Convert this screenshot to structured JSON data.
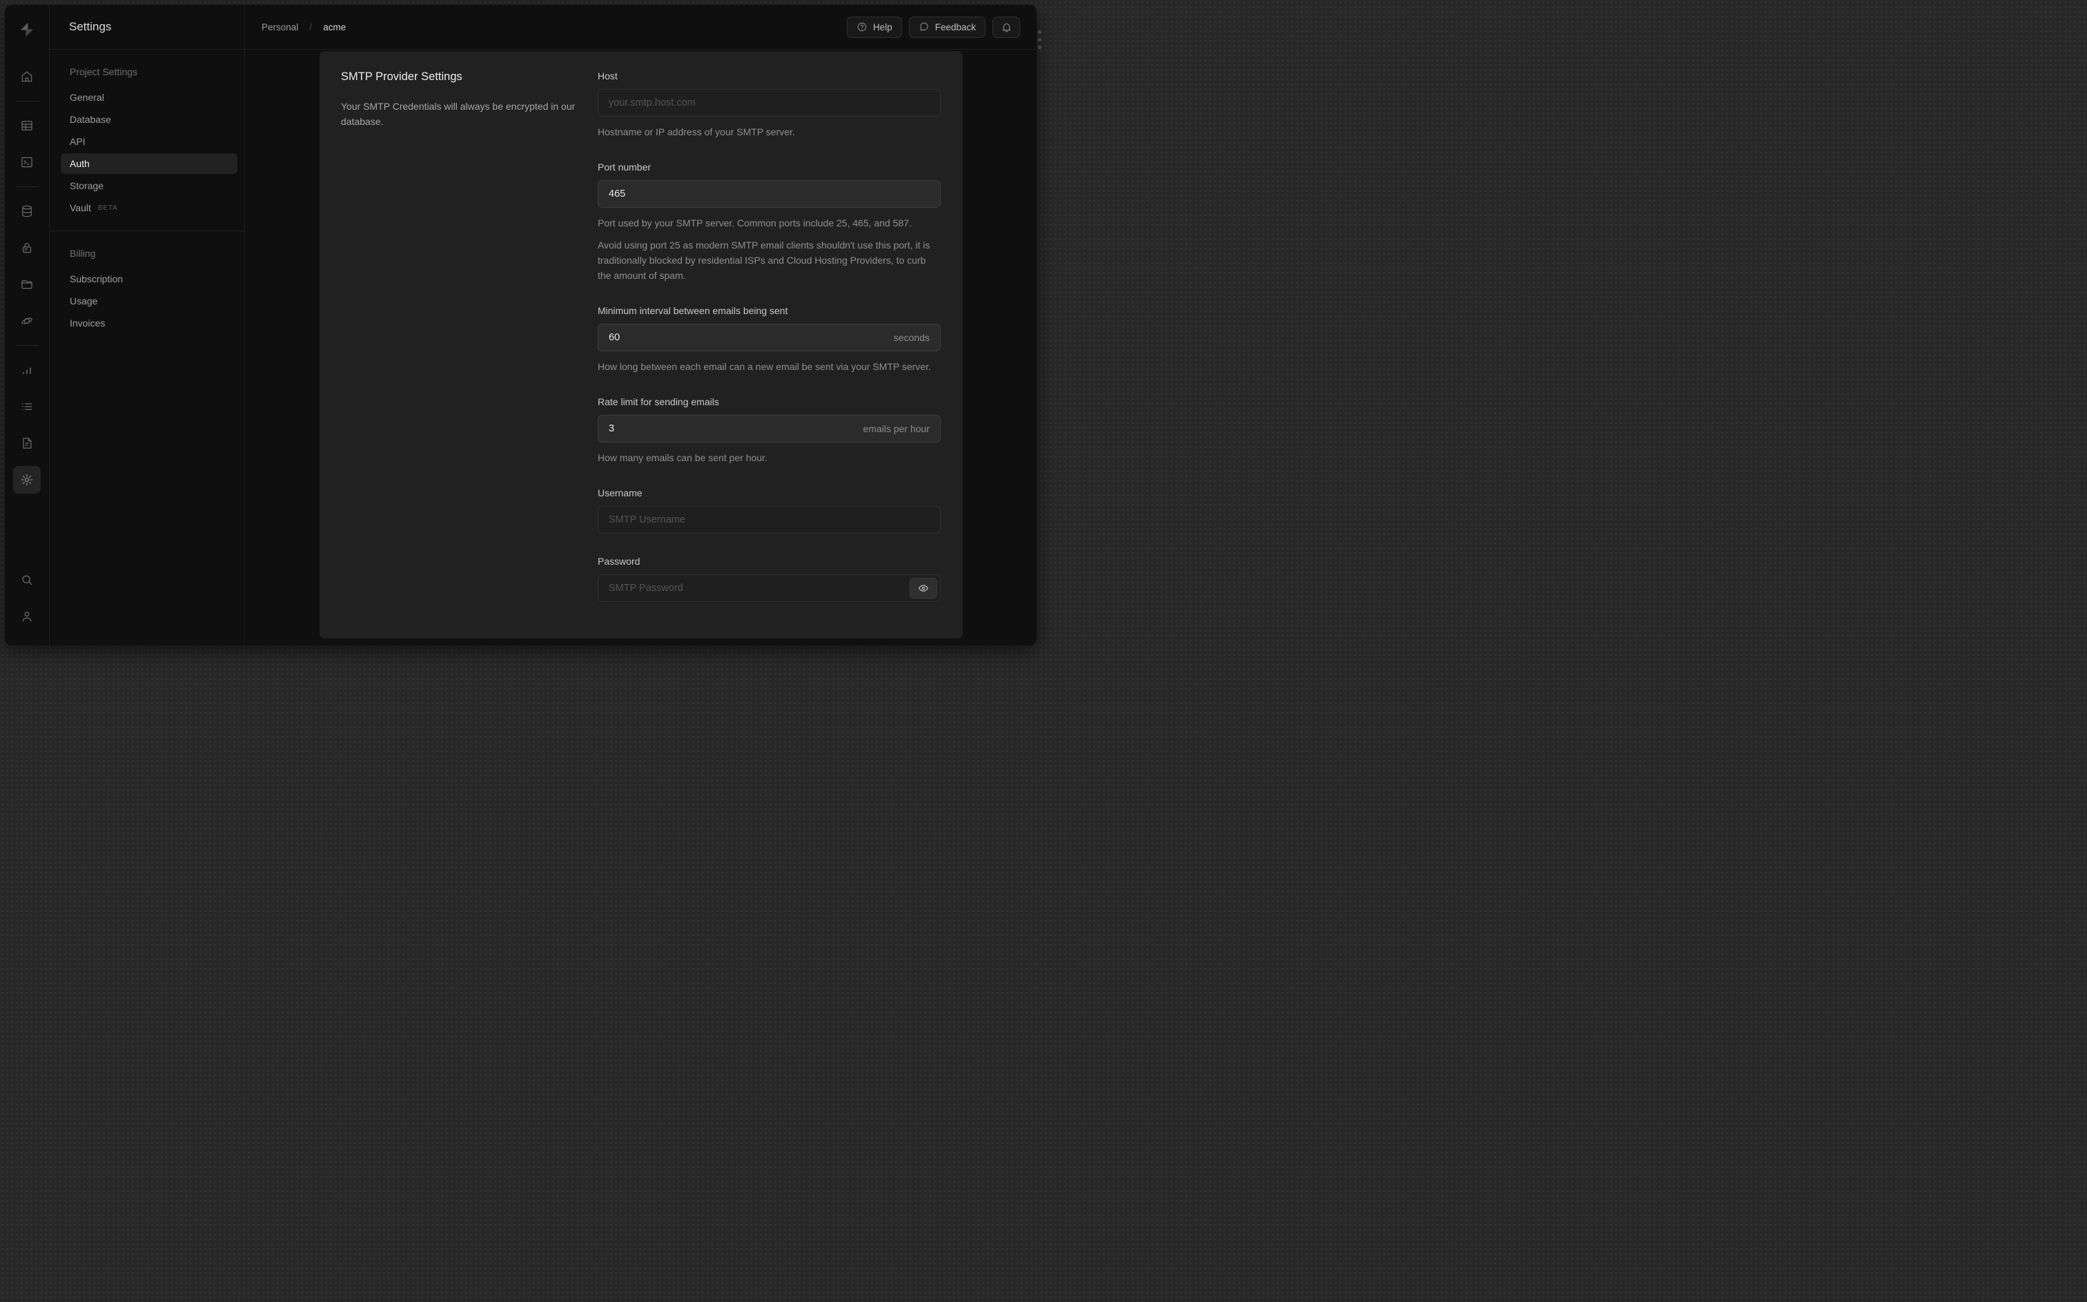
{
  "colors": {
    "desktop_bg": "#282828",
    "window_bg": "#0f0f0f",
    "card_bg": "#212121",
    "divider": "#1e1e1e",
    "active_pill": "#222222",
    "filled_input_bg": "#2b2b2b",
    "text_primary": "#ededed",
    "text_muted": "#8f8f8f"
  },
  "icon_rail": {
    "items": [
      "supabase-logo",
      "home",
      "table-editor",
      "sql-editor",
      "database",
      "auth",
      "storage",
      "edge-functions",
      "reports",
      "logs",
      "docs",
      "settings"
    ],
    "bottom_items": [
      "search",
      "user"
    ],
    "active_item": "settings"
  },
  "sidebar": {
    "title": "Settings",
    "sections": [
      {
        "label": "Project Settings",
        "items": [
          {
            "label": "General"
          },
          {
            "label": "Database"
          },
          {
            "label": "API"
          },
          {
            "label": "Auth",
            "active": true
          },
          {
            "label": "Storage"
          },
          {
            "label": "Vault",
            "badge": "BETA"
          }
        ]
      },
      {
        "label": "Billing",
        "items": [
          {
            "label": "Subscription"
          },
          {
            "label": "Usage"
          },
          {
            "label": "Invoices"
          }
        ]
      }
    ]
  },
  "topbar": {
    "breadcrumb": {
      "org": "Personal",
      "separator": "/",
      "project": "acme"
    },
    "help_label": "Help",
    "feedback_label": "Feedback",
    "icons": [
      "help-circle",
      "speech-bubble",
      "bell"
    ]
  },
  "panel": {
    "title": "SMTP Provider Settings",
    "description": "Your SMTP Credentials will always be encrypted in our database.",
    "fields": {
      "host": {
        "label": "Host",
        "value": "",
        "placeholder": "your.smtp.host.com",
        "helper": "Hostname or IP address of your SMTP server."
      },
      "port": {
        "label": "Port number",
        "value": "465",
        "helper": "Port used by your SMTP server. Common ports include 25, 465, and 587.",
        "helper2": "Avoid using port 25 as modern SMTP email clients shouldn't use this port, it is traditionally blocked by residential ISPs and Cloud Hosting Providers, to curb the amount of spam."
      },
      "interval": {
        "label": "Minimum interval between emails being sent",
        "value": "60",
        "suffix": "seconds",
        "helper": "How long between each email can a new email be sent via your SMTP server."
      },
      "rate": {
        "label": "Rate limit for sending emails",
        "value": "3",
        "suffix": "emails per hour",
        "helper": "How many emails can be sent per hour."
      },
      "username": {
        "label": "Username",
        "value": "",
        "placeholder": "SMTP Username"
      },
      "password": {
        "label": "Password",
        "value": "",
        "placeholder": "SMTP Password"
      }
    }
  }
}
